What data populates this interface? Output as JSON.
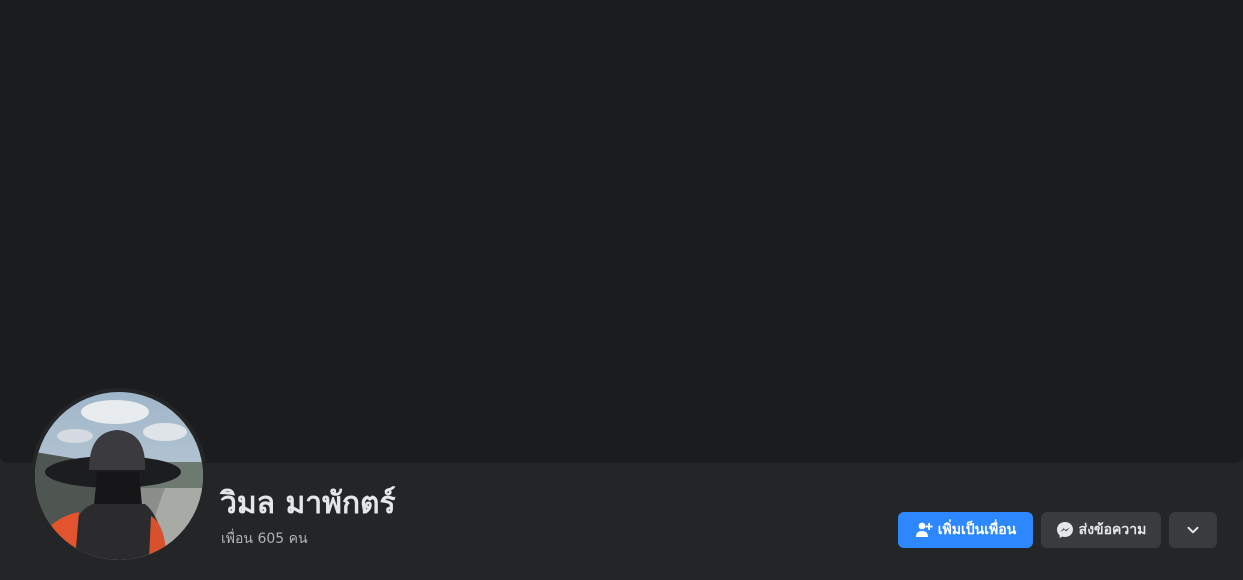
{
  "profile": {
    "name": "วิมล มาพักตร์",
    "friends_label": "เพื่อน 605 คน"
  },
  "actions": {
    "add_friend_label": "เพิ่มเป็นเพื่อน",
    "add_friend_icon": "add-friend-icon",
    "message_label": "ส่งข้อความ",
    "message_icon": "messenger-icon",
    "more_icon": "chevron-down-icon"
  },
  "colors": {
    "background": "#242526",
    "cover": "#1b1c1e",
    "primary_button": "#2d88ff",
    "secondary_button": "#3a3b3c",
    "primary_text": "#e4e6eb",
    "secondary_text": "#b0b3b8"
  }
}
